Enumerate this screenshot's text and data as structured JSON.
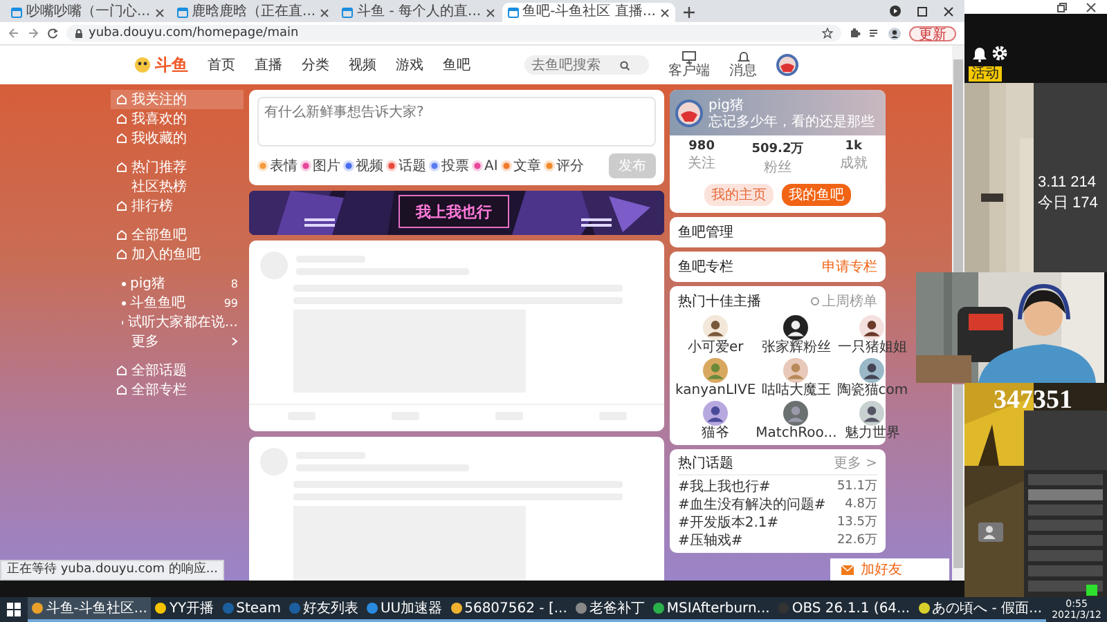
{
  "browser": {
    "tabs": [
      {
        "title": "吵嘴吵嘴（一门心...",
        "selected": false
      },
      {
        "title": "鹿晗鹿晗（正在直...",
        "selected": false
      },
      {
        "title": "斗鱼 - 每个人的直...",
        "selected": false
      },
      {
        "title": "鱼吧-斗鱼社区 直播...",
        "selected": true
      }
    ],
    "address": "yuba.douyu.com/homepage/main",
    "profile_button": "更新",
    "status_text": "正在等待 yuba.douyu.com 的响应..."
  },
  "site": {
    "logo": "斗鱼",
    "nav": [
      "首页",
      "直播",
      "分类",
      "视频",
      "游戏",
      "鱼吧"
    ],
    "search": {
      "placeholder": "去鱼吧搜索"
    },
    "header_icons": [
      "客户端",
      "消息"
    ]
  },
  "sidebar": {
    "items": [
      {
        "label": "我关注的",
        "kind": "link",
        "selected": true
      },
      {
        "label": "我喜欢的",
        "kind": "link",
        "selected": false
      },
      {
        "label": "我收藏的",
        "kind": "link",
        "selected": false
      },
      {
        "label": "热门推荐",
        "kind": "link",
        "selected": false
      },
      {
        "label": "社区热榜",
        "kind": "sub",
        "selected": false
      },
      {
        "label": "排行榜",
        "kind": "link",
        "selected": false
      },
      {
        "label": "全部鱼吧",
        "kind": "link",
        "selected": false
      },
      {
        "label": "加入的鱼吧",
        "kind": "link",
        "selected": false
      },
      {
        "label": "pig猪",
        "kind": "group",
        "selected": false,
        "badge": "8"
      },
      {
        "label": "斗鱼鱼吧",
        "kind": "group",
        "selected": false,
        "badge": "99"
      },
      {
        "label": "试听大家都在说...",
        "kind": "group",
        "selected": false
      },
      {
        "label": "更多",
        "kind": "more",
        "selected": false
      },
      {
        "label": "全部话题",
        "kind": "link",
        "selected": false
      },
      {
        "label": "全部专栏",
        "kind": "link",
        "selected": false
      }
    ]
  },
  "composer": {
    "placeholder": "有什么新鲜事想告诉大家?",
    "tools": [
      "表情",
      "图片",
      "视频",
      "话题",
      "投票",
      "AI",
      "文章",
      "评分"
    ],
    "submit": {
      "label": "发布",
      "disabled": true
    }
  },
  "banner": {
    "title": "我上我也行"
  },
  "profile": {
    "name": "pig猪",
    "bio": "忘记多少年，看的还是那些",
    "stats": [
      {
        "value": "980",
        "label": "关注"
      },
      {
        "value": "509.2万",
        "label": "粉丝"
      },
      {
        "value": "1k",
        "label": "成就"
      }
    ],
    "buttons": [
      {
        "label": "我的主页",
        "selected": false
      },
      {
        "label": "我的鱼吧",
        "selected": true
      }
    ]
  },
  "cards": [
    {
      "title": "鱼吧管理"
    },
    {
      "title": "鱼吧专栏",
      "action": "申请专栏"
    }
  ],
  "top_streamers": {
    "title": "热门十佳主播",
    "action": "上周榜单",
    "items": [
      "小可爱er",
      "张家辉粉丝",
      "一只猪姐姐",
      "kanyanLIVE",
      "咕咕大魔王",
      "陶瓷猫com",
      "猫爷",
      "MatchRoo...",
      "魅力世界"
    ]
  },
  "topics": {
    "title": "热门话题",
    "more": "更多 >",
    "rows": [
      {
        "name": "#我上我也行#",
        "count": "51.1万"
      },
      {
        "name": "#血生没有解决的问题#",
        "count": "4.8万"
      },
      {
        "name": "#开发版本2.1#",
        "count": "13.5万"
      },
      {
        "name": "#压轴戏#",
        "count": "22.6万"
      }
    ]
  },
  "float_button": "加好友",
  "overlay": {
    "badge": "活动",
    "lines": [
      "3.11 214",
      "今日 174"
    ],
    "counter": "347351"
  },
  "taskbar": {
    "items": [
      {
        "label": "斗鱼-斗鱼社区...",
        "selected": true
      },
      {
        "label": "YY开播",
        "selected": false
      },
      {
        "label": "Steam",
        "selected": false
      },
      {
        "label": "好友列表",
        "selected": false
      },
      {
        "label": "UU加速器",
        "selected": false
      },
      {
        "label": "56807562 - [...",
        "selected": false
      },
      {
        "label": "老爸补丁",
        "selected": false
      },
      {
        "label": "MSIAfterburn...",
        "selected": false
      },
      {
        "label": "OBS 26.1.1 (64...",
        "selected": false
      },
      {
        "label": "あの頃へ - 假面...",
        "selected": false
      }
    ],
    "time": "0:55",
    "date": "2021/3/12"
  }
}
